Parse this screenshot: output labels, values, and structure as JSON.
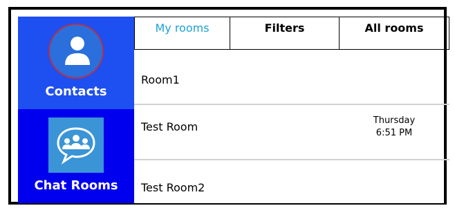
{
  "sidebar": {
    "contacts_label": "Contacts",
    "chat_label": "Chat Rooms"
  },
  "tabs": [
    {
      "label": "My rooms"
    },
    {
      "label": "Filters"
    },
    {
      "label": "All rooms"
    }
  ],
  "rooms": [
    {
      "name": "Room1"
    },
    {
      "name": "Test Room",
      "day": "Thursday",
      "time": "6:51 PM"
    },
    {
      "name": "Test Room2"
    }
  ],
  "colors": {
    "contacts_bg": "#1e4ff0",
    "chat_bg": "#0000ee",
    "active_tab": "#1aa3d4"
  },
  "icons": {
    "contacts": "person-icon",
    "chat": "chat-group-icon"
  }
}
